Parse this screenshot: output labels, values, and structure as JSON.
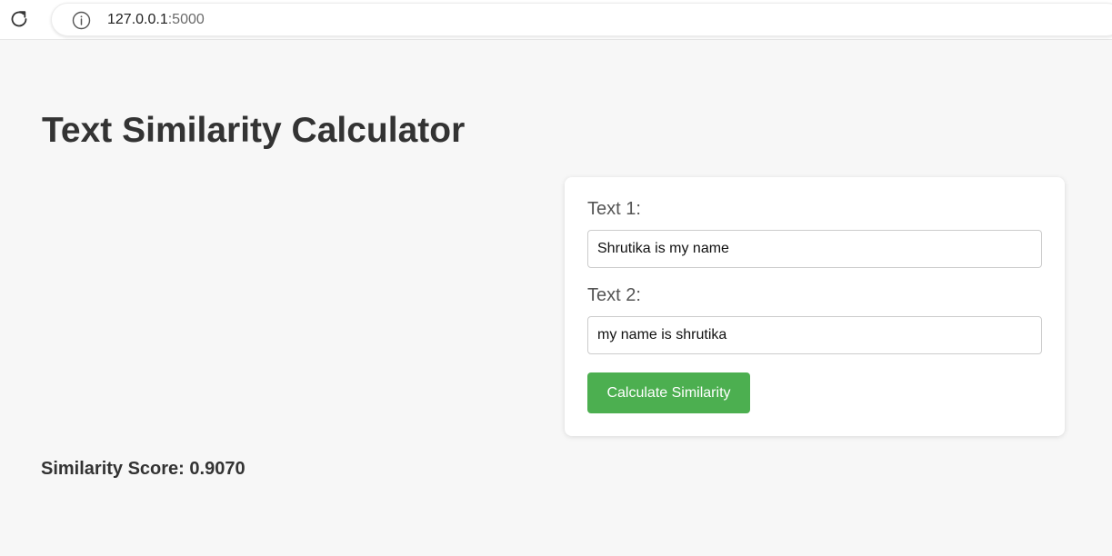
{
  "browser": {
    "url_host": "127.0.0.1",
    "url_port": ":5000",
    "icons": {
      "reload": "reload-icon",
      "info": "info-icon"
    }
  },
  "page": {
    "title": "Text Similarity Calculator"
  },
  "form": {
    "text1_label": "Text 1:",
    "text1_value": "Shrutika is my name",
    "text2_label": "Text 2:",
    "text2_value": "my name is shrutika",
    "button_label": "Calculate Similarity"
  },
  "result": {
    "label": "Similarity Score: 0.9070"
  },
  "colors": {
    "button": "#4caf50",
    "background": "#f7f7f7",
    "text": "#333333"
  }
}
